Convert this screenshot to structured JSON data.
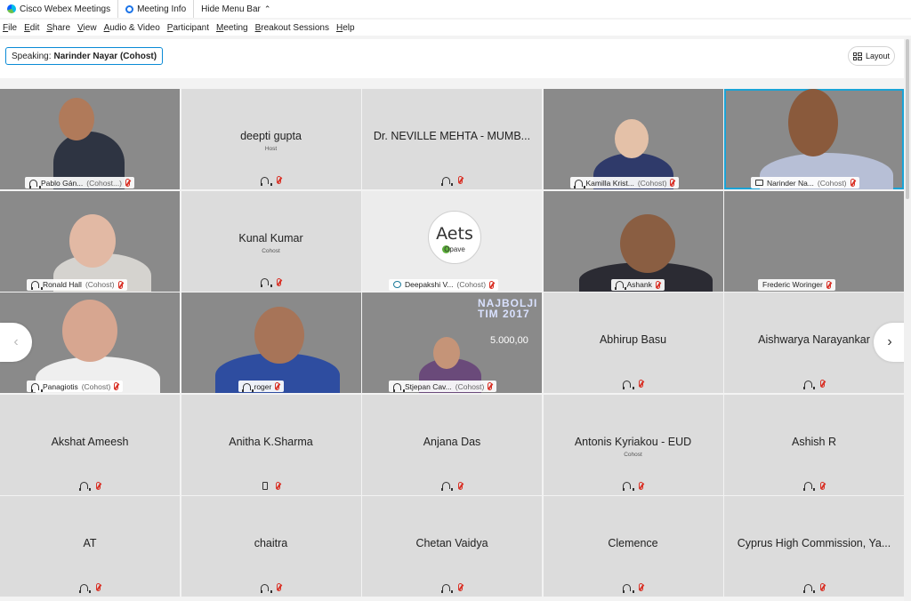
{
  "titlebar": {
    "app_name": "Cisco Webex Meetings",
    "meeting_info": "Meeting Info",
    "hide_menu": "Hide Menu Bar"
  },
  "menu": {
    "items": [
      {
        "accel": "F",
        "rest": "ile"
      },
      {
        "accel": "E",
        "rest": "dit"
      },
      {
        "accel": "S",
        "rest": "hare"
      },
      {
        "accel": "V",
        "rest": "iew"
      },
      {
        "accel": "A",
        "rest": "udio & Video"
      },
      {
        "accel": "P",
        "rest": "articipant"
      },
      {
        "accel": "M",
        "rest": "eeting"
      },
      {
        "accel": "B",
        "rest": "reakout Sessions"
      },
      {
        "accel": "H",
        "rest": "elp"
      }
    ]
  },
  "speaking": {
    "prefix": "Speaking:",
    "name": "Narinder Nayar (Cohost)"
  },
  "layout_button": "Layout",
  "tiles": [
    {
      "name": "Pablo Gán...",
      "role": "(Cohost...)",
      "video": true,
      "audio": "headset"
    },
    {
      "name": "deepti gupta",
      "role": "Host",
      "video": false,
      "audio": "headset"
    },
    {
      "name": "Dr. NEVILLE MEHTA - MUMB...",
      "role": "",
      "video": false,
      "audio": "headset"
    },
    {
      "name": "Kamilla Krist...",
      "role": "(Cohost)",
      "video": true,
      "audio": "headset"
    },
    {
      "name": "Narinder Na...",
      "role": "(Cohost)",
      "video": true,
      "audio": "screen",
      "active": true
    },
    {
      "name": "Ronald Hall",
      "role": "(Cohost)",
      "video": true,
      "audio": "headset"
    },
    {
      "name": "Kunal Kumar",
      "role": "Cohost",
      "video": false,
      "audio": "headset"
    },
    {
      "name": "Deepakshi V...",
      "role": "(Cohost)",
      "video": true,
      "audio": "share",
      "logo_text": "Aets",
      "logo_sub": "Opave"
    },
    {
      "name": "Ashank",
      "role": "",
      "video": true,
      "audio": "headset"
    },
    {
      "name": "Frederic Woringer",
      "role": "",
      "video": true,
      "audio": "none"
    },
    {
      "name": "Panagiotis",
      "role": "(Cohost)",
      "video": true,
      "audio": "headset"
    },
    {
      "name": "roger",
      "role": "",
      "video": true,
      "audio": "headset"
    },
    {
      "name": "Stjepan Cav...",
      "role": "(Cohost)",
      "video": true,
      "audio": "headset",
      "screen_line1": "NAJBOLJI",
      "screen_line2": "TIM 2017",
      "screen_num": "5.000,00"
    },
    {
      "name": "Abhirup Basu",
      "role": "",
      "video": false,
      "audio": "headset"
    },
    {
      "name": "Aishwarya Narayankar",
      "role": "",
      "video": false,
      "audio": "headset"
    },
    {
      "name": "Akshat Ameesh",
      "role": "",
      "video": false,
      "audio": "headset"
    },
    {
      "name": "Anitha K.Sharma",
      "role": "",
      "video": false,
      "audio": "phone"
    },
    {
      "name": "Anjana Das",
      "role": "",
      "video": false,
      "audio": "headset"
    },
    {
      "name": "Antonis Kyriakou - EUD",
      "role": "Cohost",
      "video": false,
      "audio": "headset"
    },
    {
      "name": "Ashish R",
      "role": "",
      "video": false,
      "audio": "headset"
    },
    {
      "name": "AT",
      "role": "",
      "video": false,
      "audio": "headset"
    },
    {
      "name": "chaitra",
      "role": "",
      "video": false,
      "audio": "headset"
    },
    {
      "name": "Chetan Vaidya",
      "role": "",
      "video": false,
      "audio": "headset"
    },
    {
      "name": "Clemence",
      "role": "",
      "video": false,
      "audio": "headset"
    },
    {
      "name": "Cyprus High Commission, Ya...",
      "role": "",
      "video": false,
      "audio": "headset"
    }
  ],
  "nav": {
    "prev": "‹",
    "next": "›"
  },
  "colors": {
    "active_border": "#1aa3d6",
    "mute_red": "#d93025",
    "tile_bg": "#dcdcdc"
  }
}
